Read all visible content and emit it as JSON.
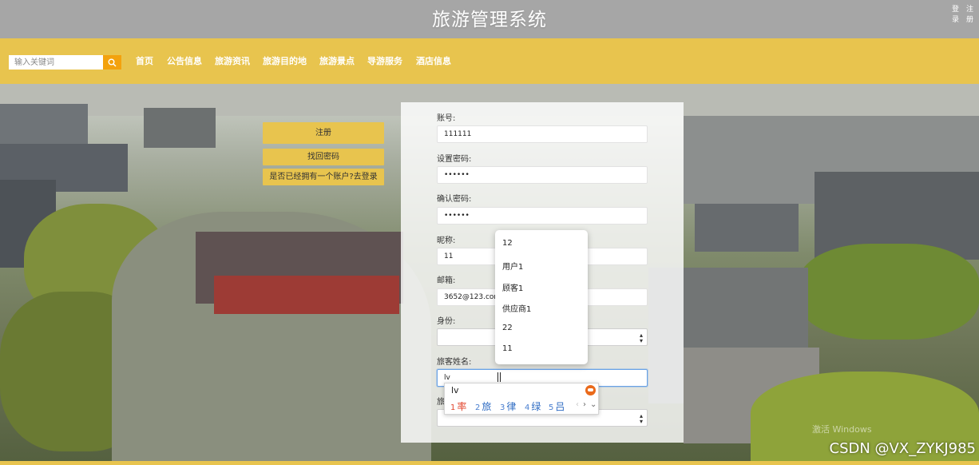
{
  "header": {
    "title": "旅游管理系统",
    "auth": {
      "login": "登录",
      "register": "注册"
    }
  },
  "search": {
    "placeholder": "输入关键词",
    "icon": "search-icon"
  },
  "nav": {
    "items": [
      "首页",
      "公告信息",
      "旅游资讯",
      "旅游目的地",
      "旅游景点",
      "导游服务",
      "酒店信息"
    ]
  },
  "side_actions": {
    "register": "注册",
    "recover": "找回密码",
    "have_account": "是否已经拥有一个账户?去登录"
  },
  "form": {
    "account_label": "账号:",
    "account_value": "111111",
    "password_label": "设置密码:",
    "password_value": "••••••",
    "confirm_label": "确认密码:",
    "confirm_value": "••••••",
    "nickname_label": "昵称:",
    "nickname_value": "11",
    "email_label": "邮箱:",
    "email_value": "3652@123.com",
    "identity_label": "身份:",
    "identity_value": "",
    "tourist_name_label": "旅客姓名:",
    "tourist_name_value": "lv",
    "last_label_partial": "旅"
  },
  "autocomplete": {
    "items": [
      "12",
      "用户1",
      "顾客1",
      "供应商1",
      "22",
      "11"
    ]
  },
  "ime": {
    "composition": "lv",
    "candidates": [
      {
        "num": "1",
        "char": "率"
      },
      {
        "num": "2",
        "char": "旅"
      },
      {
        "num": "3",
        "char": "律"
      },
      {
        "num": "4",
        "char": "绿"
      },
      {
        "num": "5",
        "char": "吕"
      }
    ],
    "prev": "‹",
    "next": "›",
    "expand": "⌄"
  },
  "watermarks": {
    "windows": "激活 Windows",
    "csdn": "CSDN @VX_ZYKJ985"
  },
  "colors": {
    "header_bg": "#a6a6a6",
    "nav_bg": "#e8c44e",
    "search_btn": "#f3a20e",
    "ime_highlight": "#e2462d",
    "ime_candidate": "#2f6cc3"
  }
}
